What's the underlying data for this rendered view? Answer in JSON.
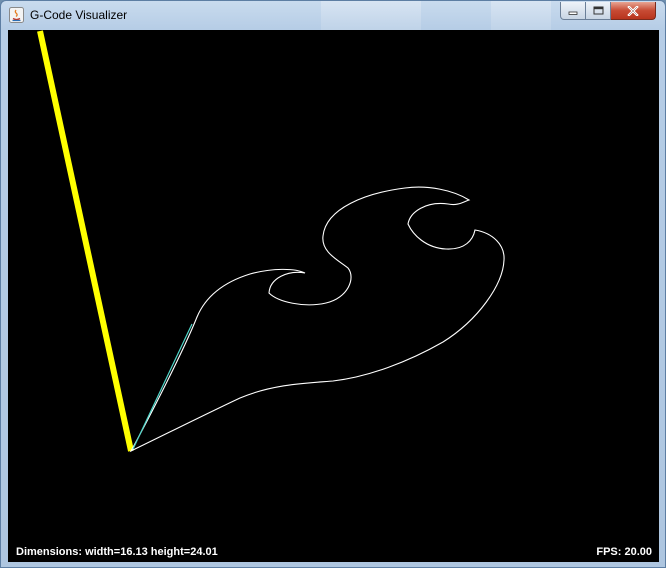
{
  "window": {
    "title": "G-Code Visualizer"
  },
  "icons": {
    "app": "java-app-icon",
    "minimize": "minimize-icon",
    "maximize": "maximize-icon",
    "close": "close-icon"
  },
  "colors": {
    "canvas_background": "#000000",
    "tool_line": "#ffff00",
    "toolpath": "#ffffff",
    "current_move": "#4fd6c9",
    "status_text": "#ffffff"
  },
  "status": {
    "dimensions": "Dimensions: width=16.13 height=24.01",
    "fps": "FPS: 20.00"
  }
}
